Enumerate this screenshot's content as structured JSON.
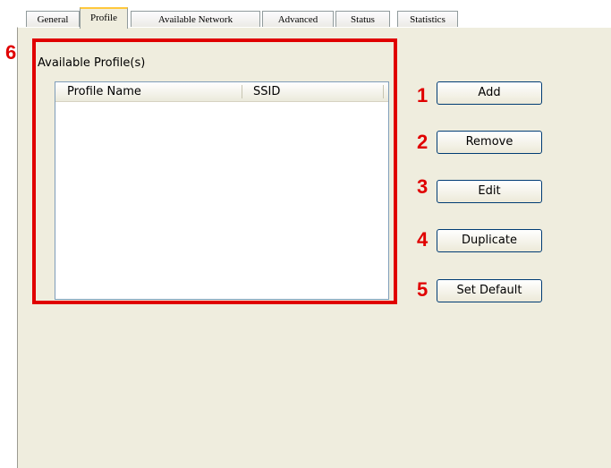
{
  "tabs": [
    {
      "label": "General"
    },
    {
      "label": "Profile"
    },
    {
      "label": "Available Network"
    },
    {
      "label": "Advanced"
    },
    {
      "label": "Status"
    },
    {
      "label": "Statistics"
    }
  ],
  "active_tab": "Profile",
  "profiles": {
    "group_label": "Available Profile(s)",
    "columns": [
      "Profile Name",
      "SSID"
    ],
    "rows": []
  },
  "buttons": {
    "add": "Add",
    "remove": "Remove",
    "edit": "Edit",
    "duplicate": "Duplicate",
    "set_default": "Set Default"
  },
  "callouts": {
    "add": "1",
    "remove": "2",
    "edit": "3",
    "duplicate": "4",
    "set_default": "5",
    "profile_list": "6"
  },
  "colors": {
    "callout": "#e00000",
    "panel_bg": "#efedde",
    "active_tab_accent": "#ffc83c"
  }
}
